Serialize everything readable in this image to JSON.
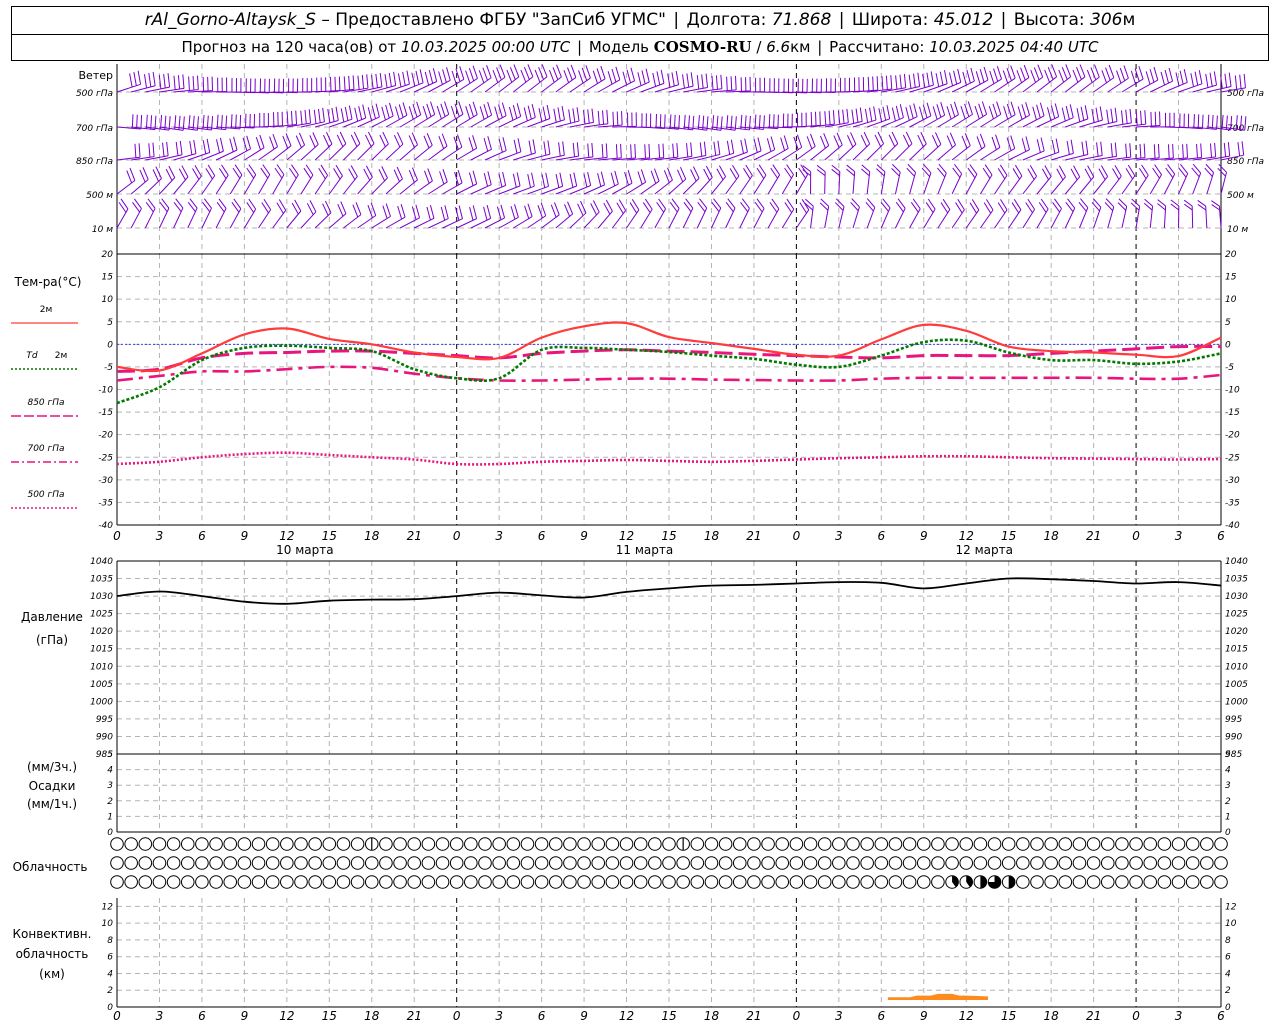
{
  "header": {
    "station": "rAl_Gorno-Altaysk_S",
    "provider_prefix": "– Предоставлено ФГБУ",
    "provider": "\"ЗапСиб УГМС\"",
    "lon_label": "Долгота:",
    "lon": "71.868",
    "lat_label": "Широта:",
    "lat": "45.012",
    "alt_label": "Высота:",
    "alt": "306",
    "alt_unit": "м",
    "forecast_label": "Прогноз на 120 часа(ов) от",
    "forecast_start": "10.03.2025 00:00 UTC",
    "model_label": "Модель",
    "model": "COSMO-RU",
    "model_sep": "/",
    "resolution": "6.6",
    "resolution_unit": "км",
    "computed_label": "Рассчитано:",
    "computed": "10.03.2025 04:40 UTC"
  },
  "colors": {
    "wind": "#7a00cc",
    "t2m": "#ff3b3b",
    "td2m": "#007a00",
    "t850": "#e8157e",
    "t700": "#e8157e",
    "t500": "#e8157e",
    "pressure": "#000000",
    "grid": "#b4b4b4",
    "conv": "#ff8a1e",
    "zero_line": "#3c3cff"
  },
  "chart_data": [
    {
      "id": "wind",
      "type": "wind_barbs",
      "title": "Ветер",
      "levels": [
        "500 гПа",
        "700 гПа",
        "850 гПа",
        "500 м",
        "10 м"
      ],
      "x_ticks": [
        "0",
        "3",
        "6",
        "9",
        "12",
        "15",
        "18",
        "21",
        "0",
        "3",
        "6",
        "9",
        "12",
        "15",
        "18",
        "21",
        "0",
        "3",
        "6",
        "9",
        "12",
        "15",
        "18",
        "21",
        "0",
        "3",
        "6"
      ]
    },
    {
      "id": "temperature",
      "type": "line",
      "title": "Тем-ра(°C)",
      "ylim": [
        -40,
        20
      ],
      "y_ticks": [
        20,
        15,
        10,
        5,
        0,
        -5,
        -10,
        -15,
        -20,
        -25,
        -30,
        -35,
        -40
      ],
      "x_hours": [
        0,
        3,
        6,
        9,
        12,
        15,
        18,
        21,
        24,
        27,
        30,
        33,
        36,
        39,
        42,
        45,
        48,
        51,
        54,
        57,
        60,
        63,
        66,
        69,
        72,
        75,
        78
      ],
      "x_ticks": [
        "0",
        "3",
        "6",
        "9",
        "12",
        "15",
        "18",
        "21",
        "0",
        "3",
        "6",
        "9",
        "12",
        "15",
        "18",
        "21",
        "0",
        "3",
        "6",
        "9",
        "12",
        "15",
        "18",
        "21",
        "0",
        "3",
        "6"
      ],
      "day_labels": [
        "10 марта",
        "11 марта",
        "12 марта"
      ],
      "series": [
        {
          "name": "2м",
          "key": "t2m",
          "style": "solid",
          "values": [
            -5,
            -5.8,
            -2,
            2.2,
            3.5,
            1.2,
            0,
            -1.8,
            -2.8,
            -3,
            1.5,
            4,
            4.7,
            1.6,
            0.3,
            -1,
            -2.3,
            -2.5,
            1.1,
            4.3,
            3,
            -0.5,
            -1.5,
            -1.8,
            -2.3,
            -2.6,
            1.5
          ]
        },
        {
          "name": "Td 2м",
          "key": "td2m",
          "style": "dotted",
          "values": [
            -13,
            -9.5,
            -3.5,
            -0.8,
            -0.3,
            -0.8,
            -1.5,
            -5.5,
            -7.5,
            -7.5,
            -1.2,
            -0.8,
            -1.2,
            -1.7,
            -2.5,
            -3.2,
            -4.5,
            -5,
            -2.5,
            0.5,
            0.8,
            -1.8,
            -3.5,
            -3.5,
            -4.3,
            -3.8,
            -2
          ]
        },
        {
          "name": "850 гПа",
          "key": "t850",
          "style": "long-dash",
          "values": [
            -6,
            -5.5,
            -3,
            -2,
            -1.8,
            -1.5,
            -1.5,
            -2,
            -2.5,
            -3,
            -2,
            -1.5,
            -1.2,
            -1.5,
            -1.8,
            -2.2,
            -2.5,
            -2.8,
            -3,
            -2.5,
            -2.5,
            -2.5,
            -2,
            -1.5,
            -1,
            -0.5,
            -0.5
          ]
        },
        {
          "name": "700 гПа",
          "key": "t700",
          "style": "dash-dot",
          "values": [
            -8,
            -7,
            -6,
            -6,
            -5.5,
            -5,
            -5.2,
            -6.5,
            -7.5,
            -8,
            -8,
            -7.8,
            -7.6,
            -7.6,
            -7.8,
            -7.9,
            -8,
            -8,
            -7.6,
            -7.4,
            -7.4,
            -7.4,
            -7.4,
            -7.4,
            -7.6,
            -7.6,
            -6.8
          ]
        },
        {
          "name": "500 гПа",
          "key": "t500",
          "style": "fine-dotted",
          "values": [
            -26.5,
            -26,
            -25,
            -24.3,
            -24,
            -24.5,
            -25,
            -25.5,
            -26.5,
            -26.5,
            -26,
            -25.8,
            -25.6,
            -25.8,
            -26,
            -25.8,
            -25.5,
            -25.2,
            -25,
            -24.8,
            -24.8,
            -25,
            -25.2,
            -25.3,
            -25.4,
            -25.5,
            -25.4
          ]
        }
      ]
    },
    {
      "id": "pressure",
      "type": "line",
      "title": "Давление",
      "subtitle": "(гПа)",
      "ylim": [
        985,
        1040
      ],
      "y_ticks": [
        1040,
        1035,
        1030,
        1025,
        1020,
        1015,
        1010,
        1005,
        1000,
        995,
        990,
        985
      ],
      "x_hours": [
        0,
        3,
        6,
        9,
        12,
        15,
        18,
        21,
        24,
        27,
        30,
        33,
        36,
        39,
        42,
        45,
        48,
        51,
        54,
        57,
        60,
        63,
        66,
        69,
        72,
        75,
        78
      ],
      "series": [
        {
          "name": "",
          "key": "pressure",
          "style": "solid",
          "values": [
            1030,
            1031.3,
            1030,
            1028.4,
            1027.8,
            1028.7,
            1029,
            1029.1,
            1030,
            1031,
            1030.2,
            1029.6,
            1031.2,
            1032.2,
            1033,
            1033.2,
            1033.6,
            1034,
            1033.8,
            1032.2,
            1033.6,
            1035,
            1034.8,
            1034.3,
            1033.6,
            1034,
            1033
          ]
        }
      ]
    },
    {
      "id": "precip",
      "type": "bar",
      "title": "Осадки",
      "label_top": "(мм/3ч.)",
      "label_bottom": "(мм/1ч.)",
      "ylim": [
        0,
        5
      ],
      "y_ticks": [
        5,
        4,
        3,
        2,
        1,
        0
      ],
      "series": [
        {
          "name": "",
          "values": []
        }
      ]
    },
    {
      "id": "clouds",
      "type": "table",
      "title": "Облачность",
      "rows": 3,
      "symbols_per_row": 79,
      "partial": [
        {
          "row": 0,
          "index": 18,
          "fill": 0.15
        },
        {
          "row": 0,
          "index": 40,
          "fill": 0.15
        },
        {
          "row": 2,
          "index": 59,
          "fill": 0.4
        },
        {
          "row": 2,
          "index": 60,
          "fill": 0.4
        },
        {
          "row": 2,
          "index": 61,
          "fill": 0.5
        },
        {
          "row": 2,
          "index": 62,
          "fill": 0.75
        },
        {
          "row": 2,
          "index": 63,
          "fill": 0.5
        }
      ]
    },
    {
      "id": "convective",
      "type": "area",
      "title": "Конвективн.",
      "title2": "облачность",
      "title3": "(км)",
      "ylim": [
        0,
        13
      ],
      "y_ticks": [
        12,
        10,
        8,
        6,
        4,
        2,
        0
      ],
      "x_ticks": [
        "0",
        "3",
        "6",
        "9",
        "12",
        "15",
        "18",
        "21",
        "0",
        "3",
        "6",
        "9",
        "12",
        "15",
        "18",
        "21",
        "0",
        "3",
        "6",
        "9",
        "12",
        "15",
        "18",
        "21",
        "0",
        "3",
        "6"
      ],
      "segments": [
        {
          "x": [
            54.5,
            56,
            56.5,
            57.5,
            58,
            59,
            59.5,
            60,
            61.5
          ],
          "bottom": [
            0.9,
            0.9,
            0.9,
            0.9,
            0.9,
            0.9,
            0.9,
            0.9,
            0.9
          ],
          "top": [
            1.1,
            1.1,
            1.3,
            1.3,
            1.5,
            1.5,
            1.3,
            1.3,
            1.2
          ]
        }
      ]
    }
  ]
}
